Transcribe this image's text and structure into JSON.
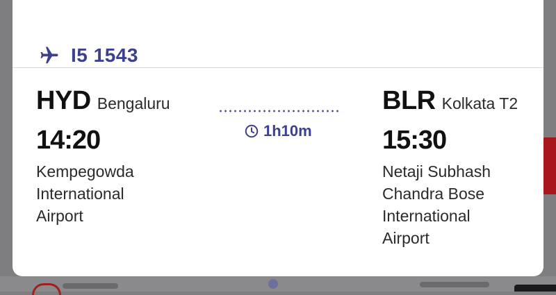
{
  "flight": {
    "number": "I5 1543",
    "duration": "1h10m"
  },
  "departure": {
    "code": "HYD",
    "city": "Bengaluru",
    "time": "14:20",
    "airport_lines": [
      "Kempegowda",
      "International",
      "Airport"
    ]
  },
  "arrival": {
    "code": "BLR",
    "city": "Kolkata T2",
    "time": "15:30",
    "airport_lines": [
      "Netaji Subhash",
      "Chandra Bose",
      "International",
      "Airport"
    ]
  },
  "icons": {
    "flight": "airplane-icon",
    "duration": "clock-icon"
  },
  "colors": {
    "accent": "#3d3f8f",
    "text": "#111111",
    "sheet": "#ffffff",
    "backdrop": "#7e7e80"
  }
}
